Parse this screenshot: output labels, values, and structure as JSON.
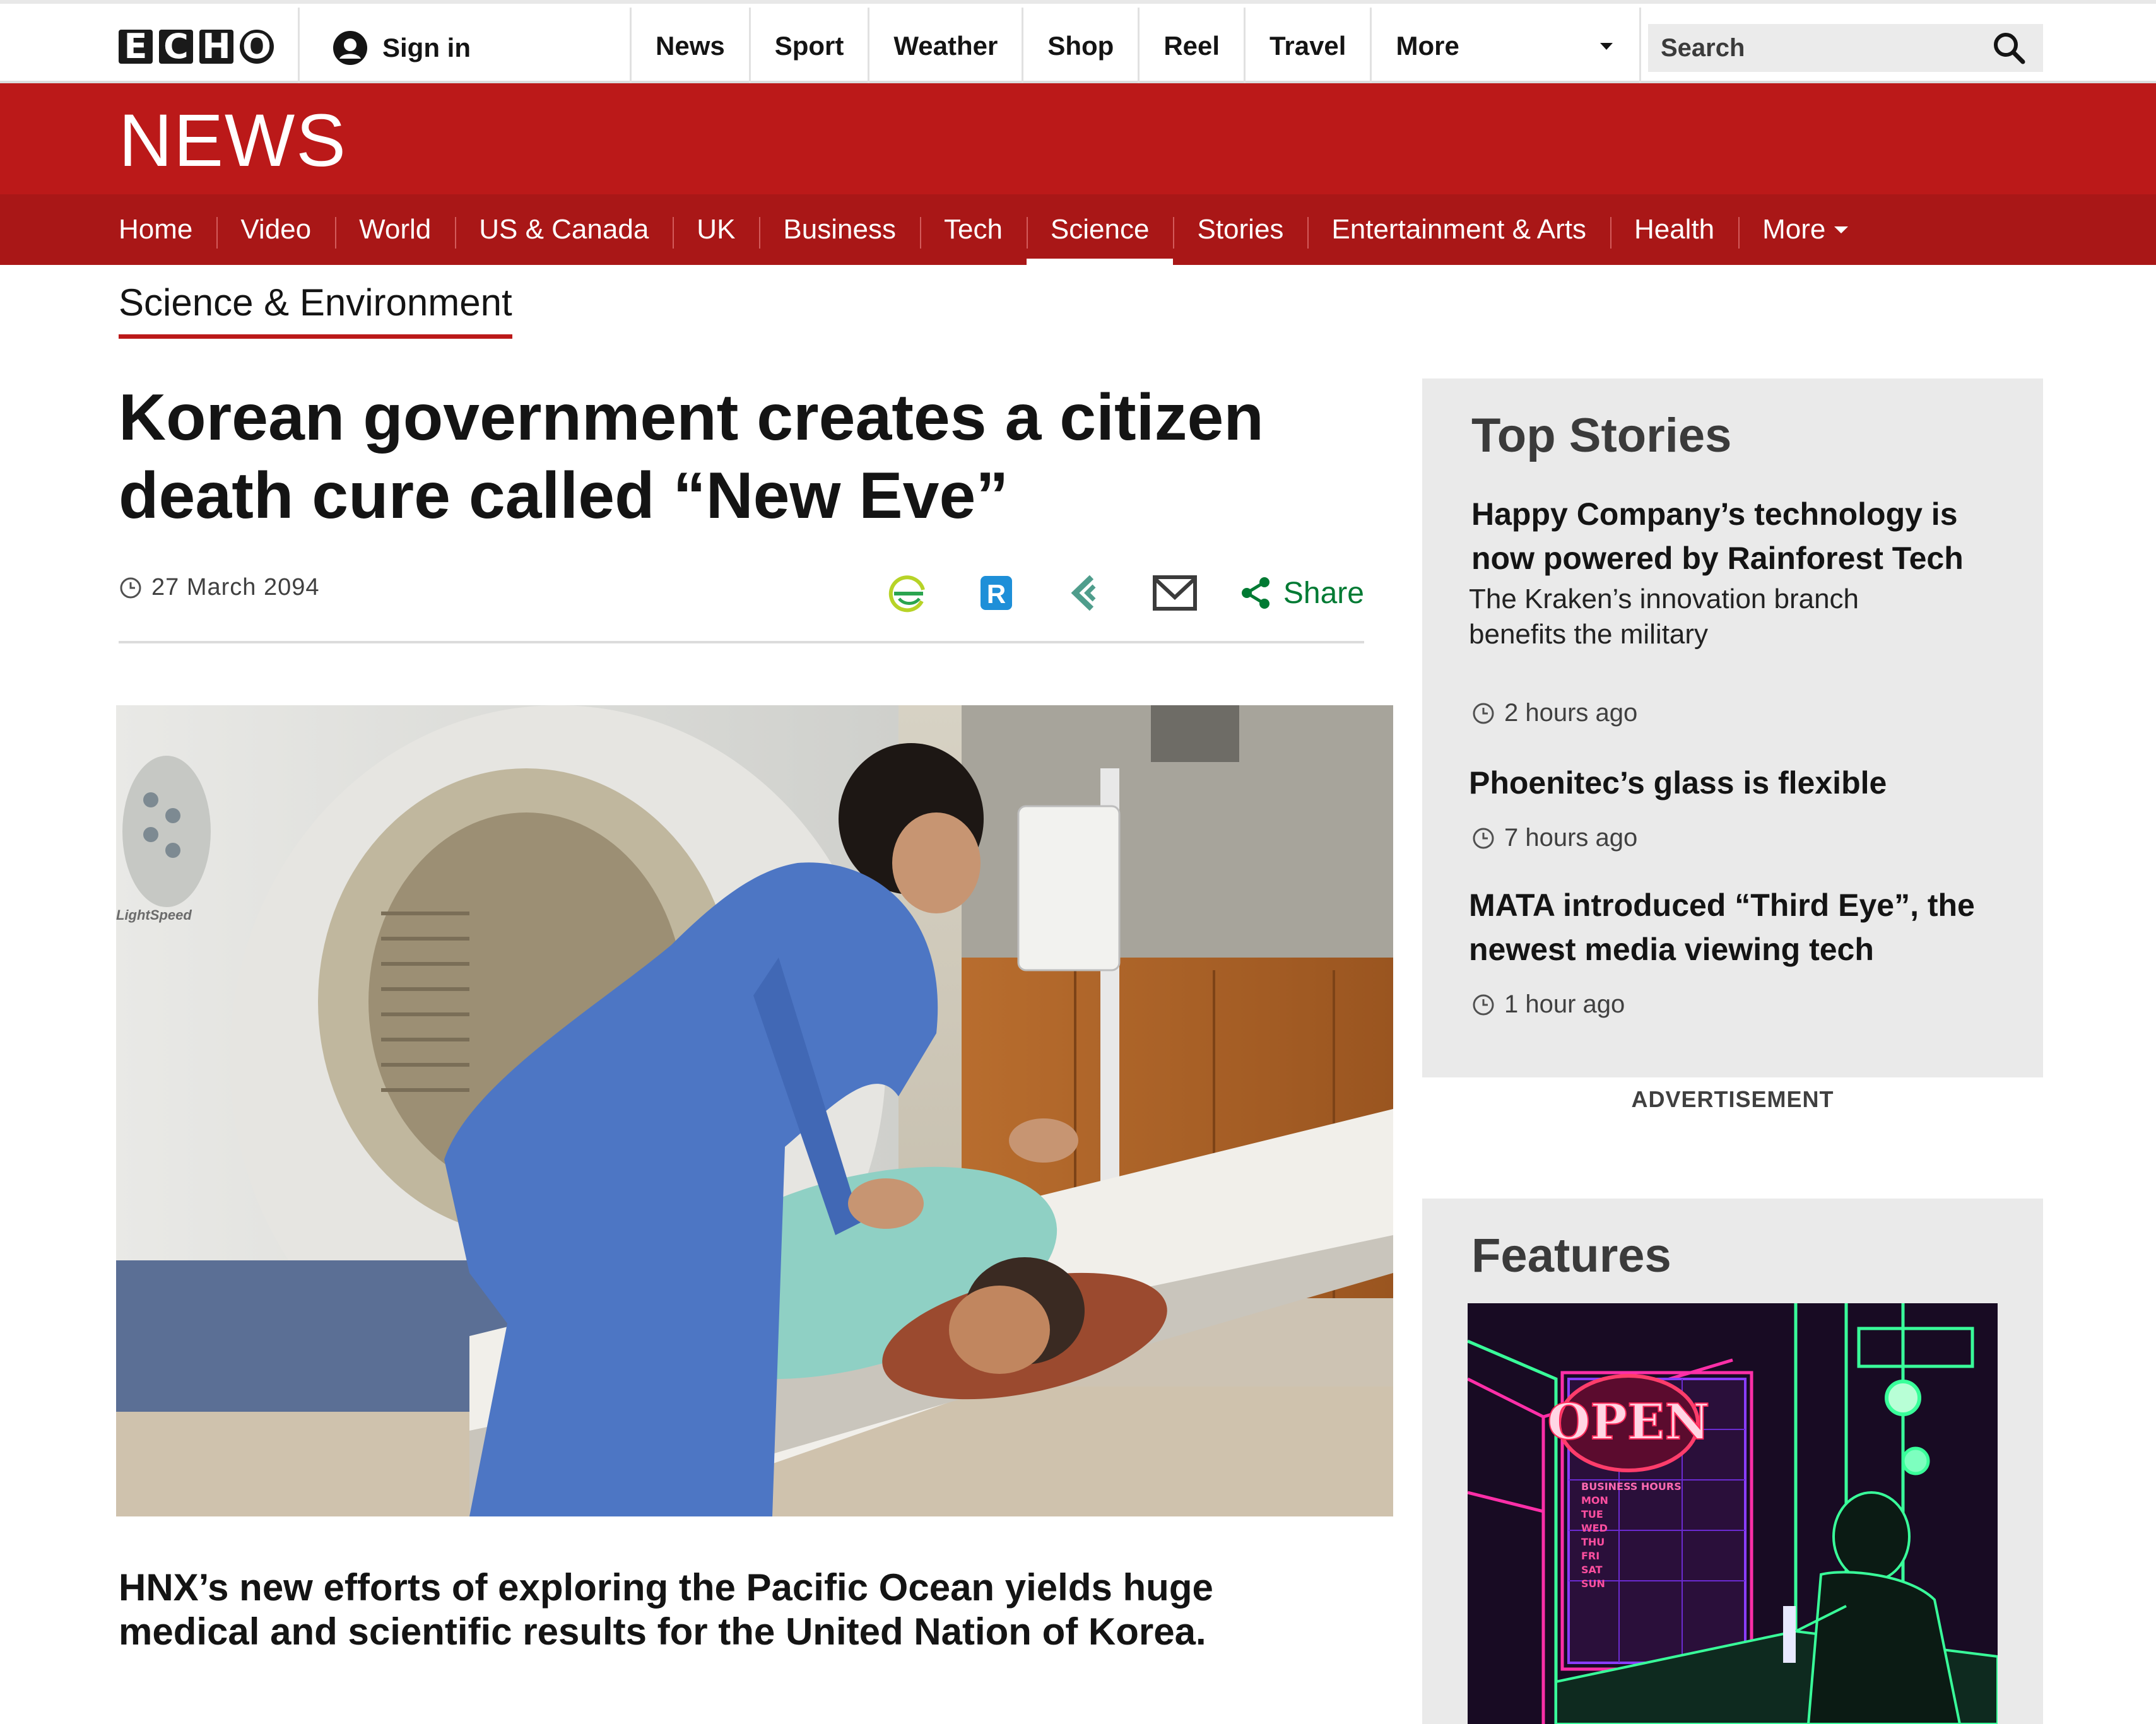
{
  "site": {
    "logo_letters": [
      "E",
      "C",
      "H",
      "O"
    ],
    "sign_in": "Sign in",
    "global_nav": [
      "News",
      "Sport",
      "Weather",
      "Shop",
      "Reel",
      "Travel"
    ],
    "global_more": "More",
    "search_placeholder": "Search"
  },
  "header": {
    "title": "NEWS",
    "subnav": [
      "Home",
      "Video",
      "World",
      "US & Canada",
      "UK",
      "Business",
      "Tech",
      "Science",
      "Stories",
      "Entertainment & Arts",
      "Health"
    ],
    "subnav_more": "More",
    "active_item": "Science"
  },
  "section": "Science & Environment",
  "article": {
    "headline": "Korean government creates a citizen death cure called “New Eve”",
    "date": "27 March 2094",
    "share_label": "Share",
    "caption": "HNX’s new efforts of exploring the Pacific Ocean yields huge medical and scientific results for the United Nation of Korea.",
    "photo_text": "LightSpeed"
  },
  "sidebar": {
    "top_stories_title": "Top Stories",
    "stories": [
      {
        "headline": "Happy Company’s technology is now powered by Rainforest Tech",
        "summary": "The Kraken’s innovation branch benefits the military",
        "time": "2 hours ago"
      },
      {
        "headline": "Phoenitec’s glass is flexible",
        "time": "7 hours ago"
      },
      {
        "headline": "MATA introduced “Third Eye”, the newest media viewing tech",
        "time": "1 hour ago"
      }
    ],
    "advertisement": "ADVERTISEMENT",
    "features_title": "Features",
    "feature_sign": "OPEN",
    "feature_hours_title": "BUSINESS HOURS",
    "feature_days": [
      "MON",
      "TUE",
      "WED",
      "THU",
      "FRI",
      "SAT",
      "SUN"
    ]
  },
  "colors": {
    "brand_red": "#bb1919",
    "subnav_red": "#a91717",
    "share_green": "#007a33",
    "panel_grey": "#eaeaea"
  },
  "icons": [
    "user-icon",
    "chevron-down-icon",
    "search-icon",
    "clock-icon",
    "messenger-icon",
    "reddit-icon",
    "feedly-icon",
    "email-icon",
    "share-icon"
  ]
}
